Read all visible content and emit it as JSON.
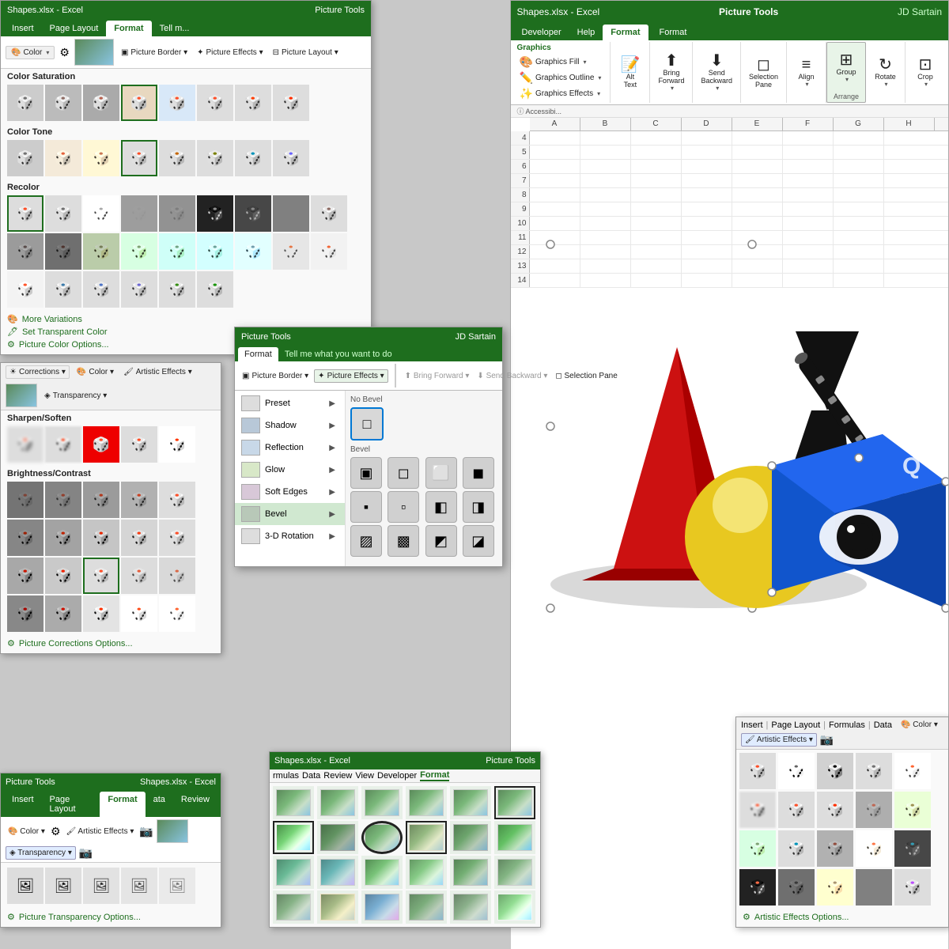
{
  "mainExcel": {
    "titleBar": {
      "left": "Shapes.xlsx - Excel",
      "center": "Picture Tools",
      "right": "JD Sartain"
    },
    "tabs": [
      "Developer",
      "Help",
      "Format",
      "Format"
    ],
    "activeTab": "Format",
    "ribbonGroups": {
      "graphicsFill": "Graphics Fill",
      "graphicsOutline": "Graphics Outline",
      "graphicsEffects": "Graphics Effects",
      "altText": "Alt Text",
      "bringForward": "Bring Forward",
      "sendBackward": "Send Backward",
      "selectionPane": "Selection Pane",
      "align": "Align",
      "group": "Group",
      "rotate": "Rotate",
      "crop": "Crop",
      "arrange": "Arrange"
    },
    "colHeaders": [
      "A",
      "B",
      "C",
      "D",
      "E",
      "F",
      "G",
      "H"
    ],
    "rows": [
      4,
      5,
      6,
      7,
      8,
      9,
      10,
      11,
      12,
      13,
      14
    ]
  },
  "panelColor": {
    "title": "Color Saturation",
    "title2": "Color Tone",
    "title3": "Recolor",
    "links": [
      "More Variations",
      "Set Transparent Color",
      "Picture Color Options..."
    ]
  },
  "panelCorrections": {
    "header": {
      "colorLabel": "Color",
      "artisticLabel": "Artistic Effects",
      "transparencyLabel": "Transparency"
    },
    "sections": [
      "Sharpen/Soften",
      "Brightness/Contrast"
    ],
    "footer": "Picture Corrections Options..."
  },
  "panelEffects": {
    "titleBar": {
      "left": "Picture Tools",
      "right": "JD Sartain"
    },
    "tabs": [
      "Format",
      "Tell me what you want to do"
    ],
    "ribbonButtons": [
      "Picture Border",
      "Picture Effects",
      "Bring Forward",
      "Send Backward",
      "Selection Pane"
    ],
    "menuItems": [
      {
        "label": "Preset",
        "hasArrow": true
      },
      {
        "label": "Shadow",
        "hasArrow": true
      },
      {
        "label": "Reflection",
        "hasArrow": true
      },
      {
        "label": "Glow",
        "hasArrow": true
      },
      {
        "label": "Soft Edges",
        "hasArrow": true
      },
      {
        "label": "Bevel",
        "hasArrow": true,
        "active": true
      },
      {
        "label": "3-D Rotation",
        "hasArrow": true
      }
    ],
    "bevelPanel": {
      "noBevelTitle": "No Bevel",
      "bevelTitle": "Bevel"
    }
  },
  "panelTransparency": {
    "titleBar": "Picture Tools  Shapes.xlsx - Excel",
    "tabs": [
      "Insert",
      "Page Layout",
      "Format",
      "ata",
      "Review"
    ],
    "activeTab": "Format",
    "sideButtons": [
      "Color",
      "Artistic Effects",
      "Transparency"
    ],
    "footer": "Picture Transparency Options..."
  },
  "panelArtistic": {
    "header": {
      "tabs": [
        "Insert",
        "Page Layout",
        "Formulas",
        "Data"
      ],
      "buttons": [
        "Color",
        "Artistic Effects"
      ]
    },
    "footer": "Artistic Effects Options..."
  },
  "panelInsert": {
    "titleBar": {
      "left": "Shapes.xlsx - Excel",
      "right": "Picture Tools"
    },
    "tabs": [
      "rmulas",
      "Data",
      "Review",
      "View",
      "Developer",
      "Format"
    ],
    "activeTab": "Format"
  },
  "icons": {
    "graphicsFill": "🎨",
    "graphicsOutline": "✏️",
    "graphicsEffects": "✨",
    "altText": "📝",
    "bringForward": "⬆",
    "sendBackward": "⬇",
    "selectionPane": "◻",
    "align": "≡",
    "group": "⊞",
    "rotate": "↻",
    "crop": "⊡",
    "corrections": "☀",
    "color": "🎨",
    "artistic": "🖌",
    "transparency": "◈",
    "picture": "🖼",
    "border": "▣",
    "effects": "✦",
    "layout": "⊟"
  }
}
